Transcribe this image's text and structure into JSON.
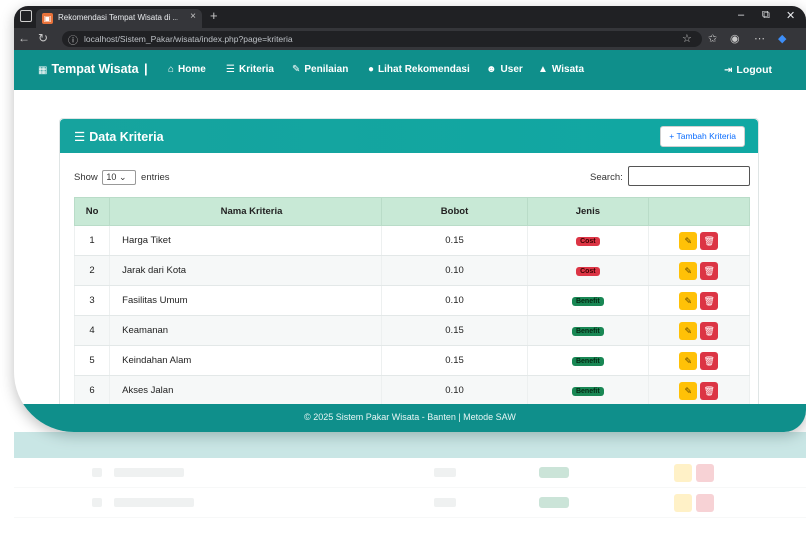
{
  "browser": {
    "tab_title": "Rekomendasi Tempat Wisata di ...",
    "tab_close": "×",
    "new_tab": "+",
    "url": "localhost/Sistem_Pakar/wisata/index.php?page=kriteria"
  },
  "navbar": {
    "brand": "Tempat Wisata",
    "brand_sep": "|",
    "items": [
      {
        "label": "Home",
        "icon": "home-icon"
      },
      {
        "label": "Kriteria",
        "icon": "sliders-icon"
      },
      {
        "label": "Penilaian",
        "icon": "edit-icon"
      },
      {
        "label": "Lihat Rekomendasi",
        "icon": "lightbulb-icon"
      },
      {
        "label": "User",
        "icon": "users-icon"
      },
      {
        "label": "Wisata",
        "icon": "mountain-icon"
      }
    ],
    "logout": "Logout"
  },
  "card": {
    "title": "Data Kriteria",
    "add_button": "+ Tambah Kriteria"
  },
  "table_controls": {
    "show_label": "Show",
    "entries_value": "10",
    "entries_label": "entries",
    "search_label": "Search:"
  },
  "table": {
    "headers": [
      "No",
      "Nama Kriteria",
      "Bobot",
      "Jenis",
      ""
    ],
    "rows": [
      {
        "no": "1",
        "nama": "Harga Tiket",
        "bobot": "0.15",
        "jenis": "Cost"
      },
      {
        "no": "2",
        "nama": "Jarak dari Kota",
        "bobot": "0.10",
        "jenis": "Cost"
      },
      {
        "no": "3",
        "nama": "Fasilitas Umum",
        "bobot": "0.10",
        "jenis": "Benefit"
      },
      {
        "no": "4",
        "nama": "Keamanan",
        "bobot": "0.15",
        "jenis": "Benefit"
      },
      {
        "no": "5",
        "nama": "Keindahan Alam",
        "bobot": "0.15",
        "jenis": "Benefit"
      },
      {
        "no": "6",
        "nama": "Akses Jalan",
        "bobot": "0.10",
        "jenis": "Benefit"
      }
    ]
  },
  "footer": {
    "text": "© 2025 Sistem Pakar Wisata - Banten | Metode SAW"
  },
  "colors": {
    "primary": "#0f8f8b",
    "header_row": "#c8e9d6",
    "cost": "#dc3545",
    "benefit": "#198754",
    "edit": "#ffc107",
    "delete": "#dc3545"
  }
}
